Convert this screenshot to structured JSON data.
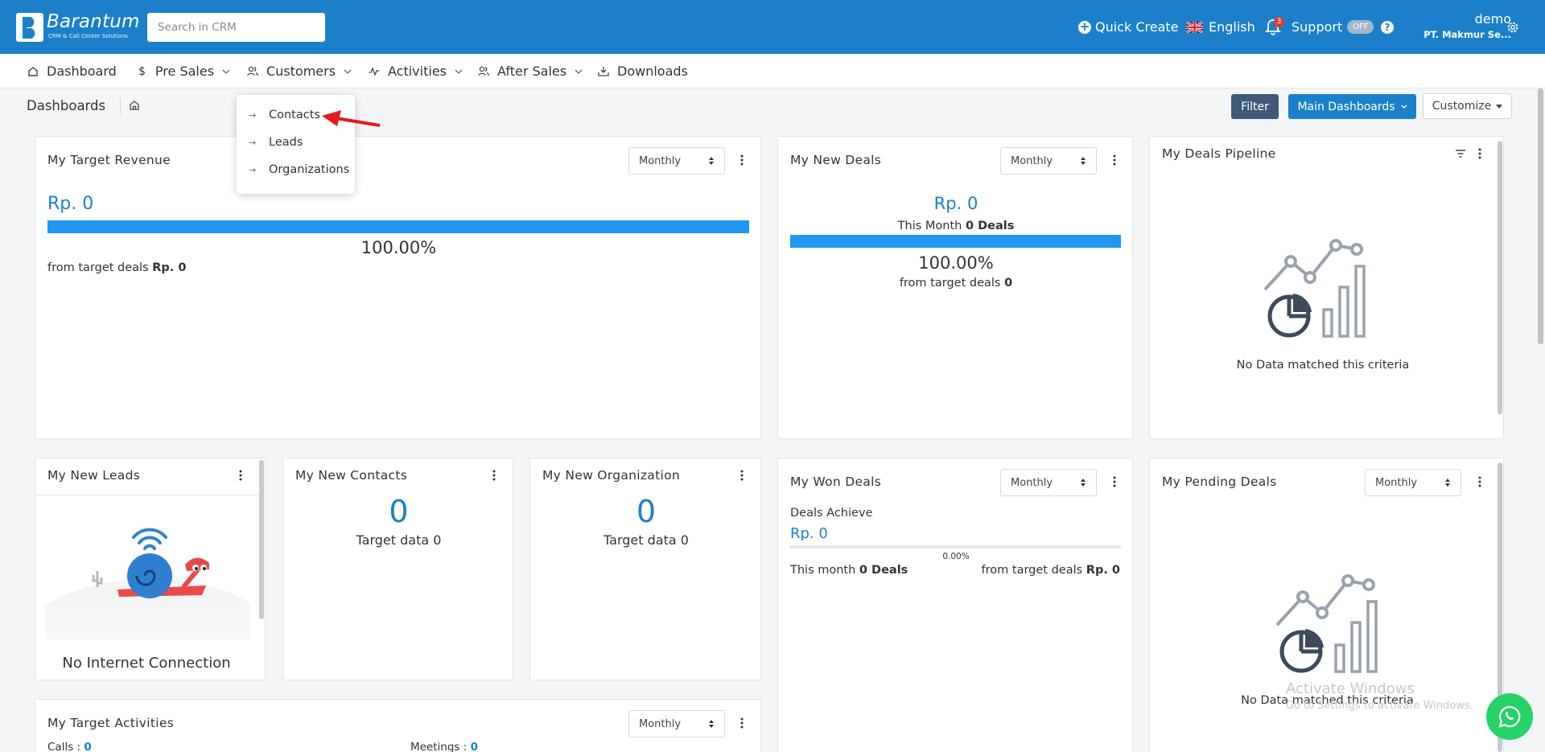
{
  "topbar": {
    "brand": {
      "name": "Barantum",
      "tagline": "CRM & Call Center Solutions"
    },
    "search_placeholder": "Search in CRM",
    "quick_create": "Quick Create",
    "language": "English",
    "notification_count": "3",
    "support": {
      "label": "Support",
      "toggle": "OFF"
    },
    "user": {
      "name": "demo",
      "company": "PT. Makmur Se..."
    },
    "colors": {
      "primary": "#1b80c9"
    }
  },
  "nav": {
    "items": [
      {
        "label": "Dashboard"
      },
      {
        "label": "Pre Sales"
      },
      {
        "label": "Customers"
      },
      {
        "label": "Activities"
      },
      {
        "label": "After Sales"
      },
      {
        "label": "Downloads"
      }
    ]
  },
  "customers_menu": [
    "Contacts",
    "Leads",
    "Organizations"
  ],
  "breadcrumb": {
    "title": "Dashboards"
  },
  "toolbar": {
    "filter": "Filter",
    "main_dashboards": "Main Dashboards",
    "customize": "Customize"
  },
  "widgets": {
    "target_revenue": {
      "title": "My Target Revenue",
      "period": "Monthly",
      "amount": "Rp. 0",
      "percent": "100.00%",
      "progress": 1.0,
      "from_label": "from target deals",
      "from_value": "Rp. 0"
    },
    "new_deals": {
      "title": "My New Deals",
      "period": "Monthly",
      "amount": "Rp. 0",
      "this_month_label": "This Month",
      "this_month_value": "0 Deals",
      "percent": "100.00%",
      "progress": 1.0,
      "from_label": "from target deals",
      "from_value": "0"
    },
    "deals_pipeline": {
      "title": "My Deals Pipeline",
      "empty": "No Data matched this criteria"
    },
    "new_leads": {
      "title": "My New Leads",
      "offline": "No Internet Connection"
    },
    "new_contacts": {
      "title": "My New Contacts",
      "count": "0",
      "target": "Target data 0"
    },
    "new_organization": {
      "title": "My New Organization",
      "count": "0",
      "target": "Target data 0"
    },
    "won_deals": {
      "title": "My Won Deals",
      "period": "Monthly",
      "achieve_label": "Deals Achieve",
      "amount": "Rp. 0",
      "percent": "0.00%",
      "progress": 0.0,
      "this_month_label": "This month",
      "this_month_value": "0 Deals",
      "from_label": "from target deals",
      "from_value": "Rp. 0"
    },
    "pending_deals": {
      "title": "My Pending Deals",
      "period": "Monthly",
      "empty": "No Data matched this criteria"
    },
    "target_activities": {
      "title": "My Target Activities",
      "period": "Monthly",
      "calls_label": "Calls :",
      "calls_value": "0",
      "meetings_label": "Meetings :",
      "meetings_value": "0"
    }
  },
  "watermark": {
    "line1": "Activate Windows",
    "line2": "Go to Settings to activate Windows."
  }
}
